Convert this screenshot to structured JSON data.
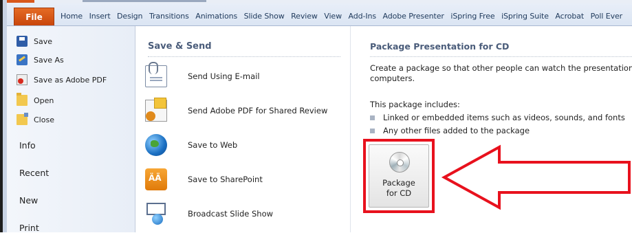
{
  "ribbon": {
    "file_tab": "File",
    "tabs": [
      "Home",
      "Insert",
      "Design",
      "Transitions",
      "Animations",
      "Slide Show",
      "Review",
      "View",
      "Add-Ins",
      "Adobe Presenter",
      "iSpring Free",
      "iSpring Suite",
      "Acrobat",
      "Poll Ever"
    ]
  },
  "leftnav": {
    "commands": [
      {
        "label": "Save",
        "icon": "save-icon"
      },
      {
        "label": "Save As",
        "icon": "save-as-icon"
      },
      {
        "label": "Save as Adobe PDF",
        "icon": "adobe-pdf-icon"
      },
      {
        "label": "Open",
        "icon": "open-folder-icon"
      },
      {
        "label": "Close",
        "icon": "close-folder-icon"
      }
    ],
    "sections": [
      "Info",
      "Recent",
      "New",
      "Print"
    ]
  },
  "save_send": {
    "title": "Save & Send",
    "options": [
      {
        "label": "Send Using E-mail",
        "icon": "email-icon"
      },
      {
        "label": "Send Adobe PDF for Shared Review",
        "icon": "pdf-review-icon"
      },
      {
        "label": "Save to Web",
        "icon": "globe-icon"
      },
      {
        "label": "Save to SharePoint",
        "icon": "sharepoint-icon"
      },
      {
        "label": "Broadcast Slide Show",
        "icon": "broadcast-icon"
      }
    ]
  },
  "package": {
    "title": "Package Presentation for CD",
    "description_line1": "Create a package so that other people can watch the presentation on",
    "description_line2": "computers.",
    "includes_label": "This package includes:",
    "items": [
      "Linked or embedded items such as videos, sounds, and fonts",
      "Any other files added to the package"
    ],
    "button_line1": "Package",
    "button_line2": "for CD"
  },
  "colors": {
    "file_tab": "#d9581c",
    "highlight": "#e8111d",
    "ribbon_bg": "#dbe5f3"
  }
}
